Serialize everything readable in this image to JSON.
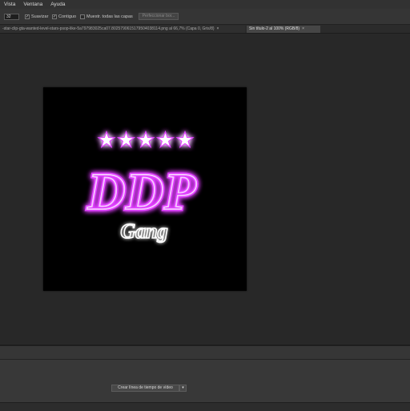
{
  "menu": {
    "items": [
      "Vista",
      "Ventana",
      "Ayuda"
    ]
  },
  "options_bar": {
    "tolerance_value": "32",
    "smooth_label": "Suavizar",
    "contiguous_label": "Contiguo",
    "sample_all_label": "Muestr. todas las capas",
    "refine_button": "Perfeccionar bor..."
  },
  "tabs": [
    {
      "label": "-star-clip-gta-wanted-level-stars-psop-like-5a797983025ca07.8025790615179504038114.png al 66,7% (Capa 0, Gris/8)",
      "close": "×"
    },
    {
      "label": "Sin título-2 al 100% (RGB/8)",
      "close": "×",
      "active": true
    }
  ],
  "artwork": {
    "text_main": "DDP",
    "text_sub": "Gang",
    "star_count": 5,
    "colors": {
      "background": "#000000",
      "neon_purple": "#e040ff",
      "neon_core": "#f6c8ff",
      "white_glow": "#ffffff"
    }
  },
  "timeline": {
    "create_button": "Crear línea de tiempo de vídeo",
    "dropdown_icon": "chevron-down-icon"
  }
}
